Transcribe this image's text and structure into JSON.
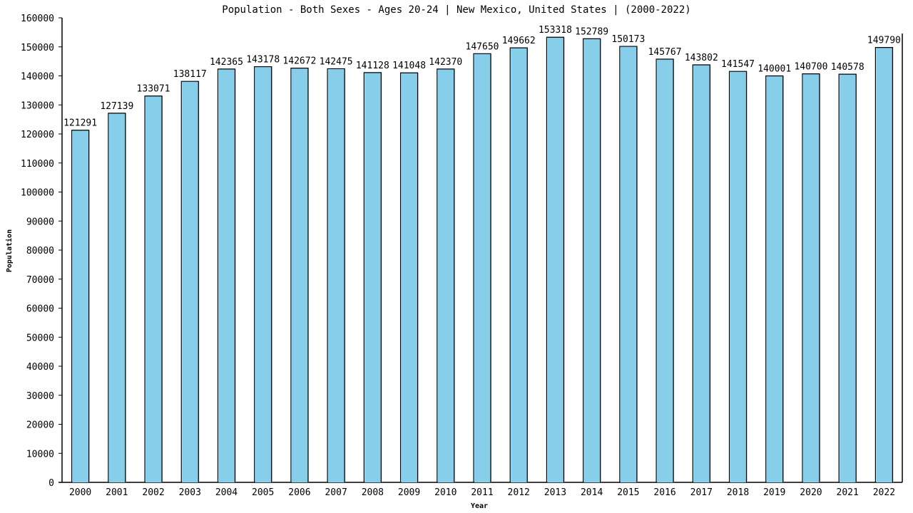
{
  "chart_data": {
    "type": "bar",
    "title": "Population - Both Sexes - Ages 20-24 | New Mexico, United States |  (2000-2022)",
    "xlabel": "Year",
    "ylabel": "Population",
    "ylim": [
      0,
      160000
    ],
    "yticks": [
      0,
      10000,
      20000,
      30000,
      40000,
      50000,
      60000,
      70000,
      80000,
      90000,
      100000,
      110000,
      120000,
      130000,
      140000,
      150000,
      160000
    ],
    "categories": [
      "2000",
      "2001",
      "2002",
      "2003",
      "2004",
      "2005",
      "2006",
      "2007",
      "2008",
      "2009",
      "2010",
      "2011",
      "2012",
      "2013",
      "2014",
      "2015",
      "2016",
      "2017",
      "2018",
      "2019",
      "2020",
      "2021",
      "2022"
    ],
    "values": [
      121291,
      127139,
      133071,
      138117,
      142365,
      143178,
      142672,
      142475,
      141128,
      141048,
      142370,
      147650,
      149662,
      153318,
      152789,
      150173,
      145767,
      143802,
      141547,
      140001,
      140700,
      140578,
      149790
    ],
    "bar_color": "#87ceeb",
    "grid": false,
    "legend": "none"
  }
}
